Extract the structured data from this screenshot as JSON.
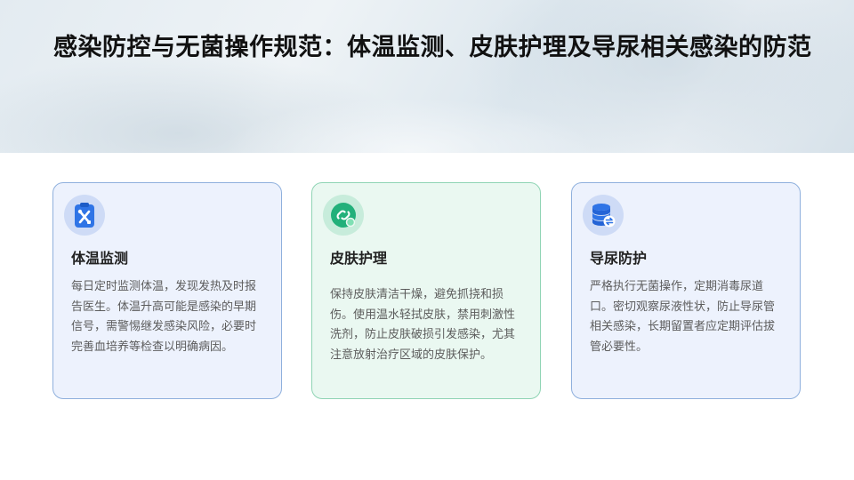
{
  "page": {
    "title": "感染防控与无菌操作规范：体温监测、皮肤护理及导尿相关感染的防范"
  },
  "cards": [
    {
      "icon": "clipboard-tools-icon",
      "title": "体温监测",
      "body": "每日定时监测体温，发现发热及时报告医生。体温升高可能是感染的早期信号，需警惕继发感染风险，必要时完善血培养等检查以明确病因。"
    },
    {
      "icon": "link-badge-icon",
      "title": "皮肤护理",
      "body": "保持皮肤清洁干燥，避免抓挠和损伤。使用温水轻拭皮肤，禁用刺激性洗剂，防止皮肤破损引发感染，尤其注意放射治疗区域的皮肤保护。"
    },
    {
      "icon": "database-exchange-icon",
      "title": "导尿防护",
      "body": "严格执行无菌操作，定期消毒尿道口。密切观察尿液性状，防止导尿管相关感染，长期留置者应定期评估拔管必要性。"
    }
  ],
  "colors": {
    "accent_blue": "#2f74e6",
    "accent_green": "#22b07a",
    "card_blue_bg": "#edf2fd",
    "card_green_bg": "#eaf8f1"
  }
}
